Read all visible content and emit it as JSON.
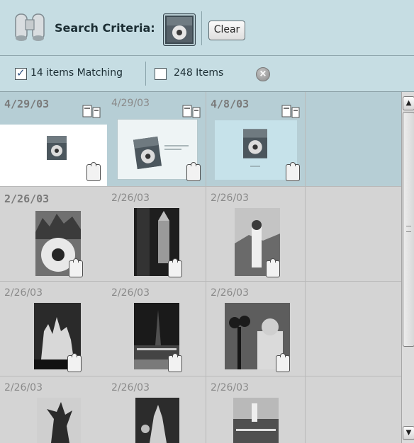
{
  "toolbar": {
    "criteria_label": "Search Criteria:",
    "clear_label": "Clear",
    "icon": "binoculars-icon"
  },
  "filterbar": {
    "matching_label": "14 items Matching",
    "matching_checked": true,
    "total_label": "248 Items",
    "total_checked": false
  },
  "grid": {
    "cells": [
      {
        "date": "4/29/03",
        "bold": true
      },
      {
        "date": "4/29/03",
        "bold": false
      },
      {
        "date": "4/8/03",
        "bold": true
      },
      {
        "date": "2/26/03",
        "bold": true
      },
      {
        "date": "2/26/03",
        "bold": false
      },
      {
        "date": "2/26/03",
        "bold": false
      },
      {
        "date": "2/26/03",
        "bold": false
      },
      {
        "date": "2/26/03",
        "bold": false
      },
      {
        "date": "2/26/03",
        "bold": false
      },
      {
        "date": "2/26/03",
        "bold": false
      },
      {
        "date": "2/26/03",
        "bold": false
      },
      {
        "date": "2/26/03",
        "bold": false
      }
    ]
  },
  "scrollbar": {
    "up_arrow": "▲",
    "down_arrow": "▼"
  },
  "colors": {
    "accent": "#c6dde3",
    "selected": "#b6ced5"
  }
}
